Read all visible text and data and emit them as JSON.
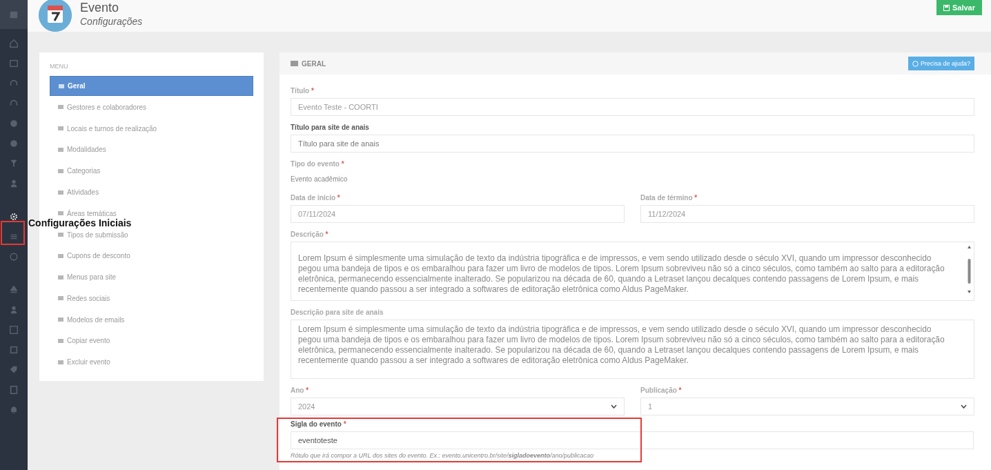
{
  "sidebar": {
    "items": [
      {
        "selected": false
      },
      {
        "selected": false
      },
      {
        "selected": false
      },
      {
        "selected": false
      },
      {
        "selected": false
      },
      {
        "selected": false
      },
      {
        "selected": false
      },
      {
        "selected": false
      },
      {
        "selected": false
      },
      {
        "selected": true
      },
      {
        "selected": false
      },
      {
        "selected": false
      },
      {
        "selected": false
      },
      {
        "selected": false
      },
      {
        "selected": false
      },
      {
        "selected": false
      },
      {
        "selected": false
      },
      {
        "selected": false
      },
      {
        "selected": false
      }
    ]
  },
  "annotation": {
    "label": "Configurações Iniciais"
  },
  "header": {
    "title": "Evento",
    "subtitle": "Configurações",
    "save_button": "Salvar"
  },
  "menu": {
    "heading": "MENU",
    "items": [
      {
        "label": "Geral",
        "selected": true
      },
      {
        "label": "Gestores e colaboradores",
        "selected": false
      },
      {
        "label": "Locais e turnos de realização",
        "selected": false
      },
      {
        "label": "Modalidades",
        "selected": false
      },
      {
        "label": "Categorias",
        "selected": false
      },
      {
        "label": "Atividades",
        "selected": false
      },
      {
        "label": "Áreas temáticas",
        "selected": false
      },
      {
        "label": "Tipos de submissão",
        "selected": false
      },
      {
        "label": "Cupons de desconto",
        "selected": false
      },
      {
        "label": "Menus para site",
        "selected": false
      },
      {
        "label": "Redes sociais",
        "selected": false
      },
      {
        "label": "Modelos de emails",
        "selected": false
      },
      {
        "label": "Copiar evento",
        "selected": false
      },
      {
        "label": "Excluir evento",
        "selected": false
      }
    ]
  },
  "panel": {
    "title": "GERAL",
    "help_button": "Precisa de ajuda?",
    "fields": [
      {
        "kind": "input",
        "label": "Título",
        "required_mark": "*",
        "disabled": true,
        "value": "Evento Teste - COORTI"
      },
      {
        "kind": "input",
        "label": "Título para site de anais",
        "disabled": false,
        "placeholder": "Título para site de anais"
      },
      {
        "kind": "static",
        "label": "Tipo do evento",
        "required_mark": "*",
        "disabled": true,
        "value": "Evento acadêmico"
      },
      {
        "kind": "row",
        "fields": [
          {
            "kind": "input",
            "label": "Data de início",
            "required_mark": "*",
            "disabled": true,
            "value": "07/11/2024"
          },
          {
            "kind": "input",
            "label": "Data de término",
            "required_mark": "*",
            "disabled": true,
            "value": "11/12/2024"
          }
        ]
      },
      {
        "kind": "scrolltextarea",
        "label": "Descrição",
        "required_mark": "*",
        "disabled": true,
        "value": "Lorem Ipsum é simplesmente uma simulação de texto da indústria tipográfica e de impressos, e vem sendo utilizado desde o século XVI, quando um impressor desconhecido pegou uma bandeja de tipos e os embaralhou para fazer um livro de modelos de tipos. Lorem Ipsum sobreviveu não só a cinco séculos, como também ao salto para a editoração eletrônica, permanecendo essencialmente inalterado. Se popularizou na década de 60, quando a Letraset lançou decalques contendo passagens de Lorem Ipsum, e mais recentemente quando passou a ser integrado a softwares de editoração eletrônica como Aldus PageMaker."
      },
      {
        "kind": "textarea",
        "label": "Descrição para site de anais",
        "disabled": true,
        "value": "Lorem Ipsum é simplesmente uma simulação de texto da indústria tipográfica e de impressos, e vem sendo utilizado desde o século XVI, quando um impressor desconhecido pegou uma bandeja de tipos e os embaralhou para fazer um livro de modelos de tipos. Lorem Ipsum sobreviveu não só a cinco séculos, como também ao salto para a editoração eletrônica, permanecendo essencialmente inalterado. Se popularizou na década de 60, quando a Letraset lançou decalques contendo passagens de Lorem Ipsum, e mais recentemente quando passou a ser integrado a softwares de editoração eletrônica como Aldus PageMaker."
      },
      {
        "kind": "row",
        "fields": [
          {
            "kind": "select",
            "label": "Ano",
            "required_mark": "*",
            "disabled": true,
            "value": "2024"
          },
          {
            "kind": "select",
            "label": "Publicação",
            "required_mark": "*",
            "disabled": true,
            "value": "1"
          }
        ]
      },
      {
        "kind": "input",
        "label": "Sigla do evento",
        "required_mark": "*",
        "disabled": false,
        "highlighted": true,
        "value": "eventoteste",
        "help": "Rótulo que irá compor a URL dos sites do evento. Ex.: evento.unicentro.br/site/**sigladoevento**/ano/publicacao"
      }
    ]
  }
}
